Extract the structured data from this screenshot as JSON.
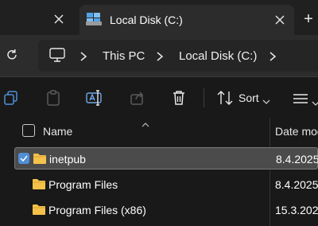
{
  "tabs": {
    "active": {
      "title": "Local Disk (C:)"
    },
    "new_tab": "+"
  },
  "address": {
    "crumbs": [
      "This PC",
      "Local Disk (C:)"
    ]
  },
  "toolbar": {
    "sort_label": "Sort"
  },
  "columns": {
    "name": "Name",
    "date": "Date mod"
  },
  "rows": [
    {
      "name": "inetpub",
      "date": "8.4.2025",
      "selected": true
    },
    {
      "name": "Program Files",
      "date": "8.4.2025",
      "selected": false
    },
    {
      "name": "Program Files (x86)",
      "date": "15.3.2025",
      "selected": false
    }
  ],
  "colors": {
    "accent": "#4f8fd8",
    "folder": "#f4c24a"
  }
}
